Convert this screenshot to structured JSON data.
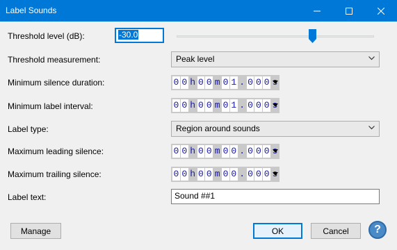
{
  "window": {
    "title": "Label Sounds"
  },
  "fields": {
    "threshold_label": "Threshold level (dB):",
    "threshold_value": "-30.0",
    "threshold_slider_fraction": 0.69,
    "measurement_label": "Threshold measurement:",
    "measurement_value": "Peak level",
    "min_silence_label": "Minimum silence duration:",
    "min_silence_value": [
      "0",
      "0",
      "h",
      "0",
      "0",
      "m",
      "0",
      "1",
      ".",
      "0",
      "0",
      "0",
      "s"
    ],
    "min_label_interval_label": "Minimum label interval:",
    "min_label_interval_value": [
      "0",
      "0",
      "h",
      "0",
      "0",
      "m",
      "0",
      "1",
      ".",
      "0",
      "0",
      "0",
      "s"
    ],
    "label_type_label": "Label type:",
    "label_type_value": "Region around sounds",
    "max_leading_label": "Maximum leading silence:",
    "max_leading_value": [
      "0",
      "0",
      "h",
      "0",
      "0",
      "m",
      "0",
      "0",
      ".",
      "0",
      "0",
      "0",
      "s"
    ],
    "max_trailing_label": "Maximum trailing silence:",
    "max_trailing_value": [
      "0",
      "0",
      "h",
      "0",
      "0",
      "m",
      "0",
      "0",
      ".",
      "0",
      "0",
      "0",
      "s"
    ],
    "label_text_label": "Label text:",
    "label_text_value": "Sound ##1"
  },
  "buttons": {
    "manage": "Manage",
    "ok": "OK",
    "cancel": "Cancel",
    "help": "?"
  },
  "colors": {
    "titlebar": "#0078d7",
    "time_digits": "#1515a0",
    "help": "#4a8ac7"
  }
}
